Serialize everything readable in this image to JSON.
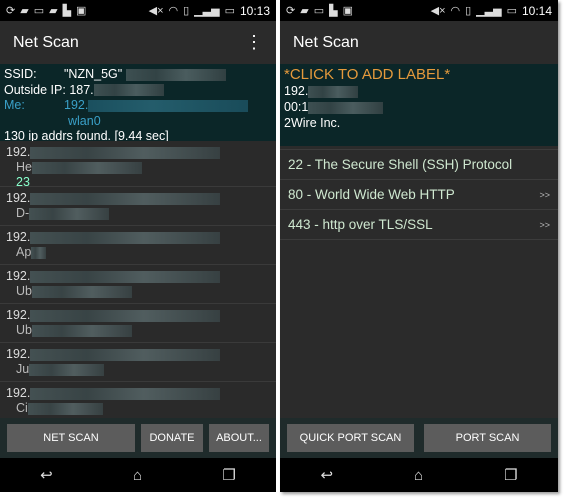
{
  "left": {
    "status_time": "10:13",
    "title": "Net Scan",
    "ssid_label": "SSID:",
    "ssid_value": "\"NZN_5G\"",
    "outside_ip_label": "Outside IP:",
    "outside_ip_value": "187.",
    "me_label": "Me:",
    "me_ip": "192.",
    "me_iface": "wlan0",
    "summary": "130 ip addrs found.  [9.44 sec]",
    "hosts": [
      {
        "ip": "192.",
        "name": "He",
        "extra": "23"
      },
      {
        "ip": "192.",
        "name": "D-"
      },
      {
        "ip": "192.",
        "name": "Ap"
      },
      {
        "ip": "192.",
        "name": "Ub"
      },
      {
        "ip": "192.",
        "name": "Ub"
      },
      {
        "ip": "192.",
        "name": "Ju"
      },
      {
        "ip": "192.",
        "name": "Ci"
      }
    ],
    "buttons": {
      "net_scan": "NET SCAN",
      "donate": "DONATE",
      "about": "ABOUT..."
    }
  },
  "right": {
    "status_time": "10:14",
    "title": "Net Scan",
    "label_prompt": "*CLICK TO ADD LABEL*",
    "ip": "192.",
    "mac": "00:1",
    "vendor": "2Wire  Inc.",
    "ports": [
      {
        "label": "22 - The Secure Shell (SSH) Protocol",
        "arrow": ""
      },
      {
        "label": "80 - World Wide Web HTTP",
        "arrow": ">>"
      },
      {
        "label": "443 - http over TLS/SSL",
        "arrow": ">>"
      }
    ],
    "buttons": {
      "quick_port_scan": "QUICK PORT SCAN",
      "port_scan": "PORT SCAN"
    }
  },
  "colors": {
    "info_bg": "#0b2628",
    "me_blue": "#3aa0c8",
    "label_orange": "#e59a3c",
    "button": "#5c5c5c"
  }
}
